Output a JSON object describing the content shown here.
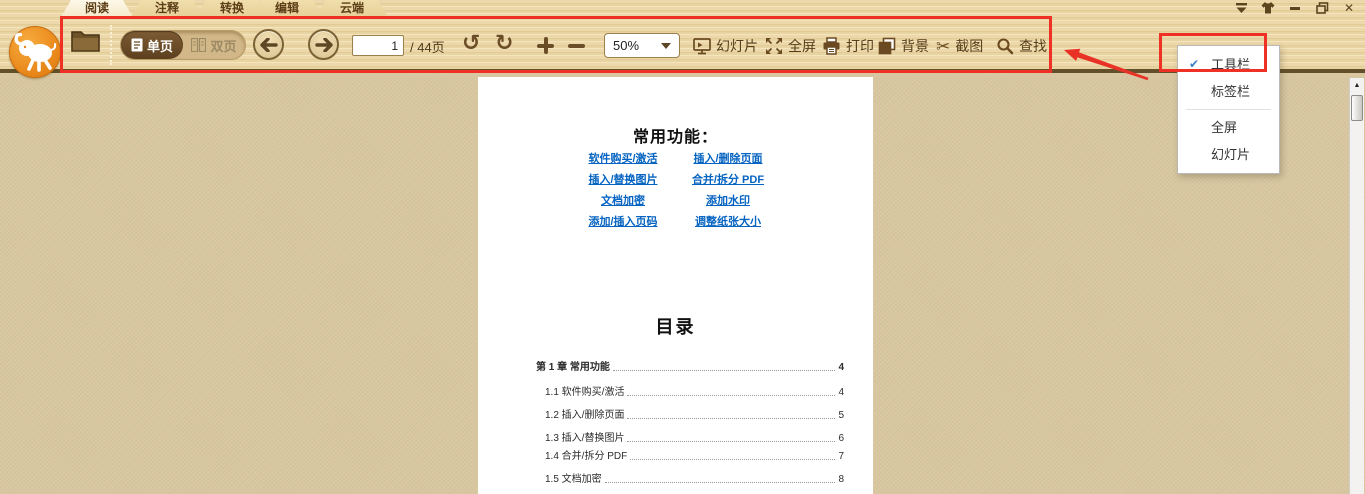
{
  "tabs": [
    {
      "label": "阅读",
      "active": true
    },
    {
      "label": "注释",
      "active": false
    },
    {
      "label": "转换",
      "active": false
    },
    {
      "label": "编辑",
      "active": false
    },
    {
      "label": "云端",
      "active": false
    }
  ],
  "toolbar": {
    "view_single": "单页",
    "view_double": "双页",
    "page_value": "1",
    "page_total": "/ 44页",
    "zoom_value": "50%",
    "actions": [
      {
        "label": "幻灯片",
        "icon": "slideshow-icon"
      },
      {
        "label": "全屏",
        "icon": "fullscreen-icon"
      },
      {
        "label": "打印",
        "icon": "print-icon"
      },
      {
        "label": "背景",
        "icon": "background-icon"
      },
      {
        "label": "截图",
        "icon": "scissors-icon"
      },
      {
        "label": "查找",
        "icon": "search-icon"
      }
    ],
    "scissors_glyph": "✂"
  },
  "context_menu": {
    "check_glyph": "✔",
    "items": [
      {
        "label": "工具栏",
        "checked": true
      },
      {
        "label": "标签栏",
        "checked": false
      },
      {
        "label": "全屏",
        "checked": false
      },
      {
        "label": "幻灯片",
        "checked": false
      }
    ]
  },
  "window_controls": {
    "close_glyph": "✕",
    "icons": [
      "window-menu-icon",
      "skin-icon",
      "minimize-icon",
      "restore-icon",
      "close-icon"
    ]
  },
  "scrollbar": {
    "up_glyph": "▲"
  },
  "pdf": {
    "section_title": "常用功能：",
    "links_left": [
      "软件购买/激活",
      "插入/替换图片",
      "文档加密",
      "添加/插入页码"
    ],
    "links_right": [
      "插入/删除页面",
      "合并/拆分 PDF",
      "添加水印",
      "调整纸张大小"
    ],
    "toc_title": "目录",
    "toc": [
      {
        "label": "第 1 章 常用功能",
        "page": "4",
        "bold": true,
        "indent": false
      },
      {
        "label": "1.1 软件购买/激活",
        "page": "4",
        "bold": false,
        "indent": true
      },
      {
        "label": "1.2 插入/删除页面",
        "page": "5",
        "bold": false,
        "indent": true
      },
      {
        "label": "1.3 插入/替换图片",
        "page": "6",
        "bold": false,
        "indent": true
      },
      {
        "label": "1.4 合并/拆分 PDF",
        "page": "7",
        "bold": false,
        "indent": true
      },
      {
        "label": "1.5 文档加密",
        "page": "8",
        "bold": false,
        "indent": true
      }
    ]
  },
  "colors": {
    "annotation_red": "#ee3124",
    "link_blue": "#0563c1",
    "check_blue": "#3f7fc1"
  }
}
